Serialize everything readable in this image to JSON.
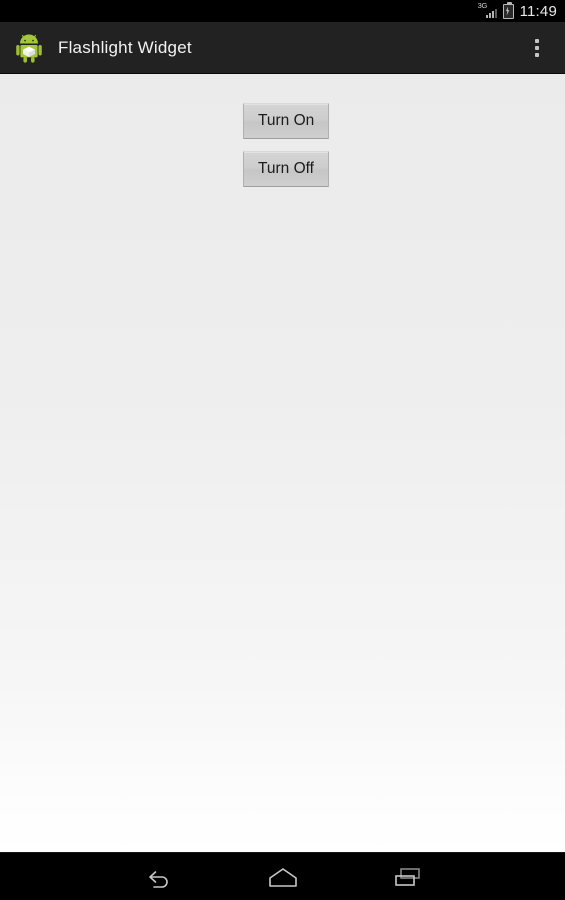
{
  "status_bar": {
    "network_label": "3G",
    "signal_icon": "signal-bars-icon",
    "battery_icon": "battery-charging-icon",
    "time": "11:49"
  },
  "action_bar": {
    "logo_icon": "android-robot-icon",
    "title": "Flashlight Widget",
    "overflow_icon": "overflow-menu-icon"
  },
  "main": {
    "buttons": [
      {
        "label": "Turn On",
        "name": "turn-on-button"
      },
      {
        "label": "Turn Off",
        "name": "turn-off-button"
      }
    ]
  },
  "nav_bar": {
    "back_icon": "back-arrow-icon",
    "home_icon": "home-icon",
    "recents_icon": "recent-apps-icon"
  },
  "colors": {
    "action_bar": "#222222",
    "status_bar": "#000000",
    "content_top": "#ebebeb",
    "content_bottom": "#ffffff",
    "button_face": "#cdcdcd",
    "nav_bar": "#000000",
    "robot_green": "#a4c639"
  }
}
